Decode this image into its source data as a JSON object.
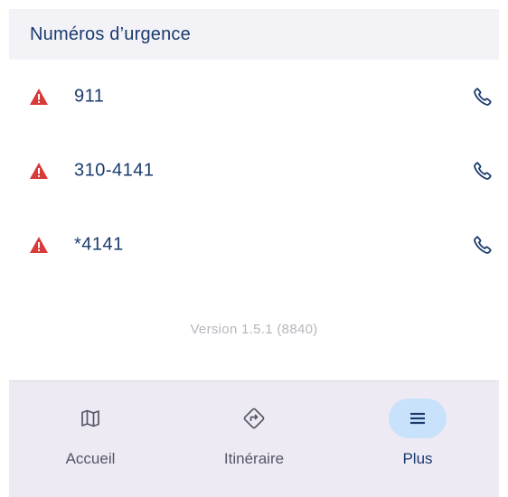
{
  "section": {
    "title": "Numéros d’urgence"
  },
  "emergency_numbers": [
    {
      "number": "911",
      "icon": "warning-icon",
      "action_icon": "phone-icon"
    },
    {
      "number": "310-4141",
      "icon": "warning-icon",
      "action_icon": "phone-icon"
    },
    {
      "number": "*4141",
      "icon": "warning-icon",
      "action_icon": "phone-icon"
    }
  ],
  "version_text": "Version 1.5.1 (8840)",
  "bottom_nav": {
    "items": [
      {
        "label": "Accueil",
        "icon": "map-icon",
        "active": false
      },
      {
        "label": "Itinéraire",
        "icon": "directions-icon",
        "active": false
      },
      {
        "label": "Plus",
        "icon": "menu-icon",
        "active": true
      }
    ]
  },
  "colors": {
    "accent": "#1a3a6e",
    "warning": "#d93a3a",
    "active_pill": "#c9e2fb",
    "nav_background": "#eeeaf4",
    "header_background": "#f3f3f7"
  }
}
